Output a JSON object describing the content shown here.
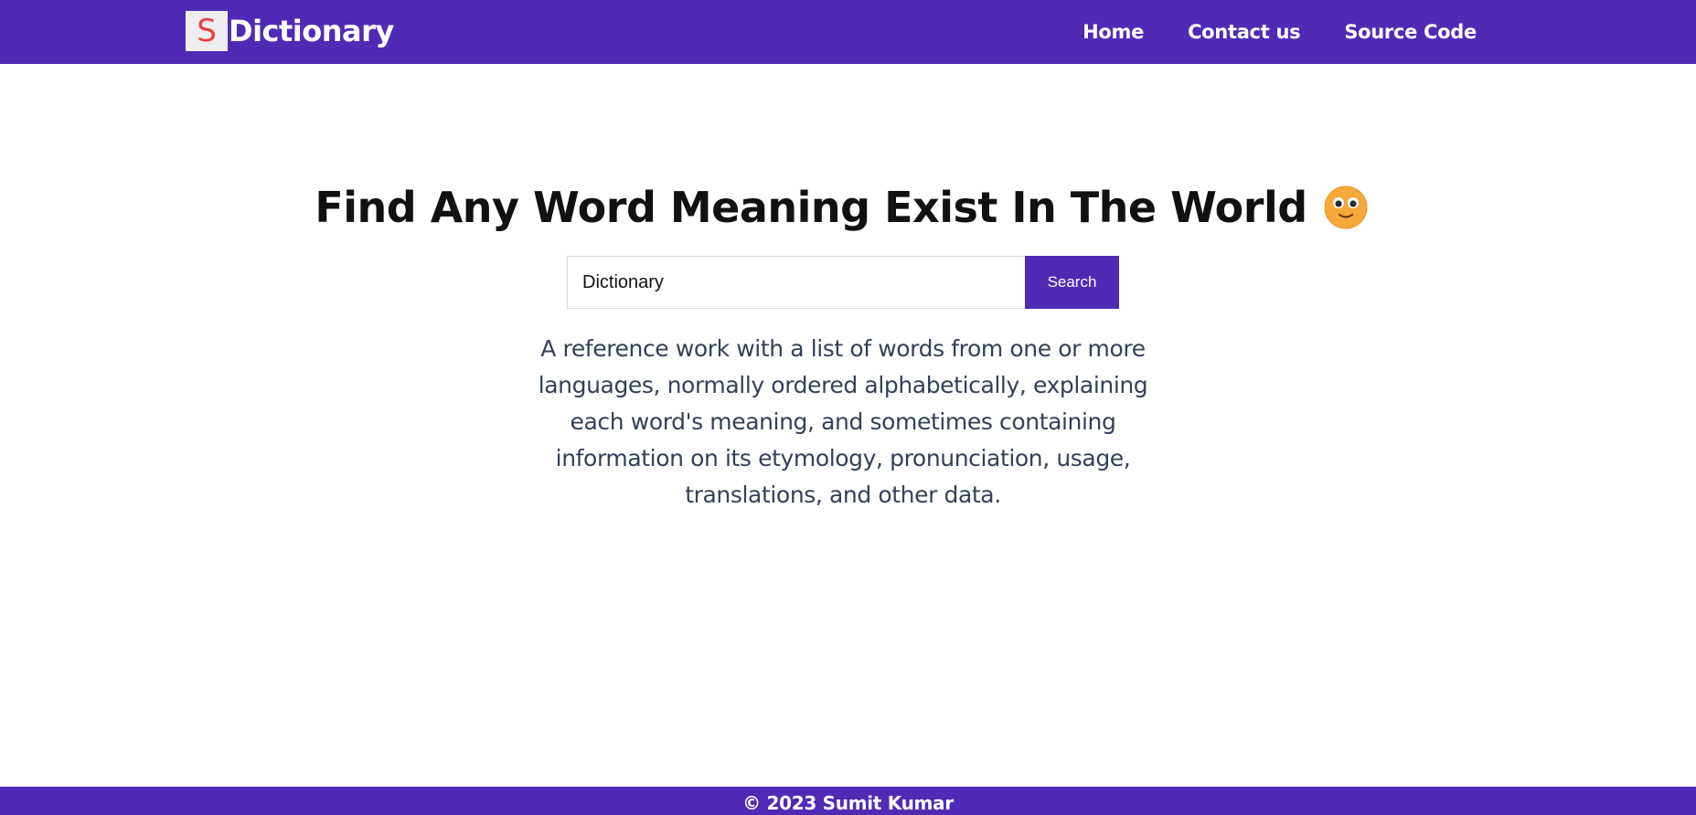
{
  "brand": {
    "badge_letter": "S",
    "name": "Dictionary",
    "badge_color": "#e84040",
    "primary_color": "#4f2bb5"
  },
  "nav": {
    "links": [
      {
        "label": "Home"
      },
      {
        "label": "Contact us"
      },
      {
        "label": "Source Code"
      }
    ]
  },
  "main": {
    "headline": "Find Any Word Meaning Exist In The World",
    "headline_icon": "smiley-face-icon",
    "search": {
      "value": "Dictionary",
      "placeholder": "",
      "button_label": "Search"
    },
    "description": "A reference work with a list of words from one or more languages, normally ordered alphabetically, explaining each word's meaning, and sometimes containing information on its etymology, pronunciation, usage, translations, and other data."
  },
  "footer": {
    "text": "© 2023 Sumit Kumar"
  }
}
